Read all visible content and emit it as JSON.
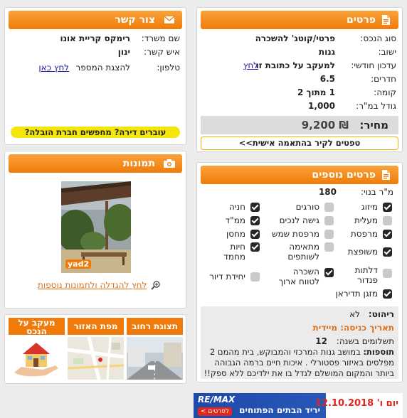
{
  "details": {
    "title": "פרטים",
    "rows": [
      {
        "label": "סוג הנכס:",
        "value": "פרטי/קוטג' להשכרה"
      },
      {
        "label": "ישוב:",
        "value": "גנות"
      },
      {
        "label": "עדכון חודשי:",
        "value": "למעקב על כתובת זו",
        "link": "לחץ"
      },
      {
        "label": "חדרים:",
        "value": "6.5"
      },
      {
        "label": "קומה:",
        "value": "1 מתוך 2"
      },
      {
        "label": "גודל במ\"ר:",
        "value": "1,000"
      }
    ],
    "price_label": "מחיר:",
    "price_value": "₪ 9,200",
    "tips_button": "טפטים לקיר בהתאמה אישית>>"
  },
  "contact": {
    "title": "צור קשר",
    "office_label": "שם משרד:",
    "office_value": "רימקס קריית אונו",
    "person_label": "איש קשר:",
    "person_value": "ינון",
    "phone_label": "טלפון:",
    "phone_text": "להצגת המספר",
    "phone_link": "לחץ כאן",
    "moving_banner": "עוברים דירה? מחפשים חברת הובלה?"
  },
  "extra": {
    "title": "פרטים נוספים",
    "built_label": "מ\"ר בנוי:",
    "built_value": "180",
    "features": [
      {
        "label": "מיזוג",
        "checked": true
      },
      {
        "label": "סורגים",
        "checked": false
      },
      {
        "label": "חניה",
        "checked": true
      },
      {
        "label": "מעלית",
        "checked": false
      },
      {
        "label": "גישה לנכים",
        "checked": false
      },
      {
        "label": "ממ\"ד",
        "checked": true
      },
      {
        "label": "מרפסת",
        "checked": true
      },
      {
        "label": "מרפסת שמש",
        "checked": false
      },
      {
        "label": "מחסן",
        "checked": true
      },
      {
        "label": "משופצת",
        "checked": true
      },
      {
        "label": "מתאימה לשותפים",
        "checked": false
      },
      {
        "label": "חיות מחמד",
        "checked": true
      },
      {
        "label": "דלתות פנדור",
        "checked": false
      },
      {
        "label": "השכרה לטווח ארוך",
        "checked": true
      },
      {
        "label": "יחידת דיור",
        "checked": false
      },
      {
        "label": "מזגן תדיראן",
        "checked": true
      }
    ],
    "furniture_label": "ריהוט:",
    "furniture_value": "לא",
    "entry_date": "תאריך כניסה: מיידית",
    "payments_label": "תשלומים בשנה:",
    "payments_value": "12",
    "additions_label": "תוספות:",
    "additions_text": "במושב גנות המרכזי והמבוקש, בית מהמם 2 מפלסים באיזור פסטורלי . איכות חיים ברמה הגבוהה ביותר והמקום המושלם לגדל בו את ילדיכם ללא ספק!!"
  },
  "photos": {
    "title": "תמונות",
    "watermark": "yad2",
    "enlarge_link": "לחץ להגדלה ולתמונות נוספות"
  },
  "tabs": {
    "items": [
      "תצוגת רחוב",
      "מפת האזור",
      "מעקב על הנכס"
    ]
  },
  "ad": {
    "date": "יום ו' 12.10.2018",
    "brand": "RE/MAX",
    "tagline": "יריד הבתים הפתוחים",
    "details_button": "לפרטים >"
  },
  "colors": {
    "accent_orange": "#f07b0a",
    "banner_yellow": "#f4e50a",
    "link_blue": "#1a1aa6",
    "entry_date_orange": "#e0711b",
    "remax_blue": "#1f4aa8",
    "remax_red": "#e1261c"
  }
}
